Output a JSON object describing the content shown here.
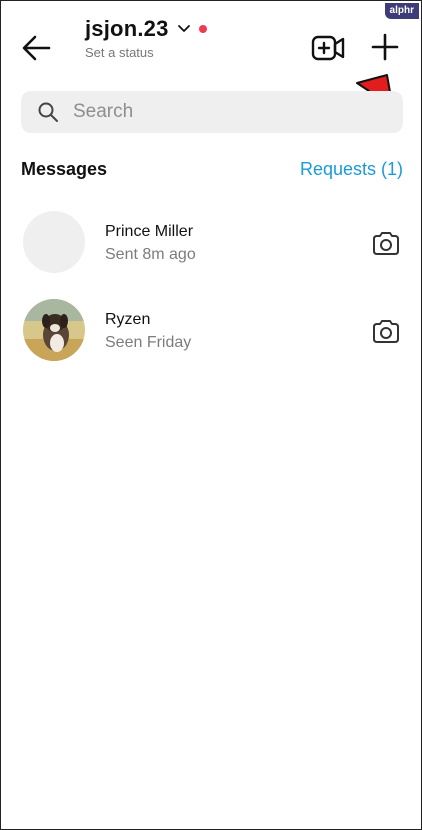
{
  "watermark": "alphr",
  "header": {
    "username": "jsjon.23",
    "status_placeholder": "Set a status",
    "icons": {
      "back": "back-arrow-icon",
      "dropdown": "chevron-down-icon",
      "video": "video-call-add-icon",
      "new": "plus-icon"
    },
    "online_dot_color": "#ef3b4f"
  },
  "search": {
    "placeholder": "Search"
  },
  "section": {
    "title": "Messages",
    "requests_label": "Requests (1)",
    "requests_color": "#1a9bd7"
  },
  "conversations": [
    {
      "name": "Prince Miller",
      "subtitle": "Sent 8m ago",
      "avatar": "blank",
      "action_icon": "camera-icon"
    },
    {
      "name": "Ryzen",
      "subtitle": "Seen Friday",
      "avatar": "dog-photo",
      "action_icon": "camera-icon"
    }
  ],
  "annotation": {
    "color": "#e11d1d",
    "icon": "red-pointer-arrow"
  }
}
